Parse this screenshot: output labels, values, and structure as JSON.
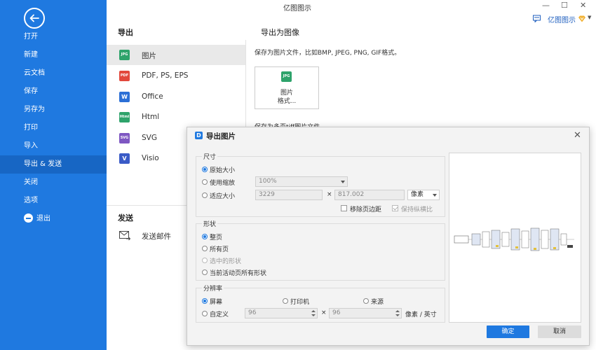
{
  "app": {
    "title": "亿图图示",
    "user_label": "亿图图示"
  },
  "sidebar": {
    "items": [
      {
        "label": "打开"
      },
      {
        "label": "新建"
      },
      {
        "label": "云文档"
      },
      {
        "label": "保存"
      },
      {
        "label": "另存为"
      },
      {
        "label": "打印"
      },
      {
        "label": "导入"
      },
      {
        "label": "导出 & 发送",
        "active": true
      },
      {
        "label": "关闭"
      },
      {
        "label": "选项"
      },
      {
        "label": "退出"
      }
    ]
  },
  "export_panel": {
    "title": "导出",
    "formats": [
      {
        "label": "图片",
        "icon": "jpg-file-icon",
        "badge": "JPG",
        "color": "#2ea36b",
        "active": true
      },
      {
        "label": "PDF, PS, EPS",
        "icon": "pdf-file-icon",
        "badge": "PDF",
        "color": "#e2483c"
      },
      {
        "label": "Office",
        "icon": "word-file-icon",
        "badge": "W",
        "color": "#2b6fd6"
      },
      {
        "label": "Html",
        "icon": "html-file-icon",
        "badge": "Html",
        "color": "#2ea36b"
      },
      {
        "label": "SVG",
        "icon": "svg-file-icon",
        "badge": "SVG",
        "color": "#7e57c2"
      },
      {
        "label": "Visio",
        "icon": "visio-file-icon",
        "badge": "V",
        "color": "#3a5bc7"
      }
    ],
    "send_title": "发送",
    "send_mail": "发送邮件"
  },
  "image_panel": {
    "title": "导出为图像",
    "description": "保存为图片文件，比如BMP, JPEG, PNG, GIF格式。",
    "card_badge": "JPG",
    "card_label": "图片\n格式...",
    "behind_text": "保存为多页tiff图片文件"
  },
  "dialog": {
    "title": "导出图片",
    "size": {
      "label": "尺寸",
      "original": "原始大小",
      "use_zoom": "使用缩放",
      "zoom_value": "100%",
      "fit_size": "适应大小",
      "width": "3229",
      "height": "817.002",
      "unit": "像素",
      "remove_margin": "移除页边距",
      "keep_ratio": "保持纵横比"
    },
    "shape": {
      "label": "形状",
      "whole_page": "整页",
      "all_pages": "所有页",
      "selected": "选中的形状",
      "current_page_all": "当前活动页所有形状"
    },
    "resolution": {
      "label": "分辨率",
      "screen": "屏幕",
      "printer": "打印机",
      "source": "来源",
      "custom": "自定义",
      "x_value": "96",
      "y_value": "96",
      "unit": "像素 / 英寸"
    },
    "times": "×",
    "ok": "确定",
    "cancel": "取消"
  },
  "colors": {
    "accent": "#1f79e0",
    "sidebar_active": "#1766c4"
  }
}
